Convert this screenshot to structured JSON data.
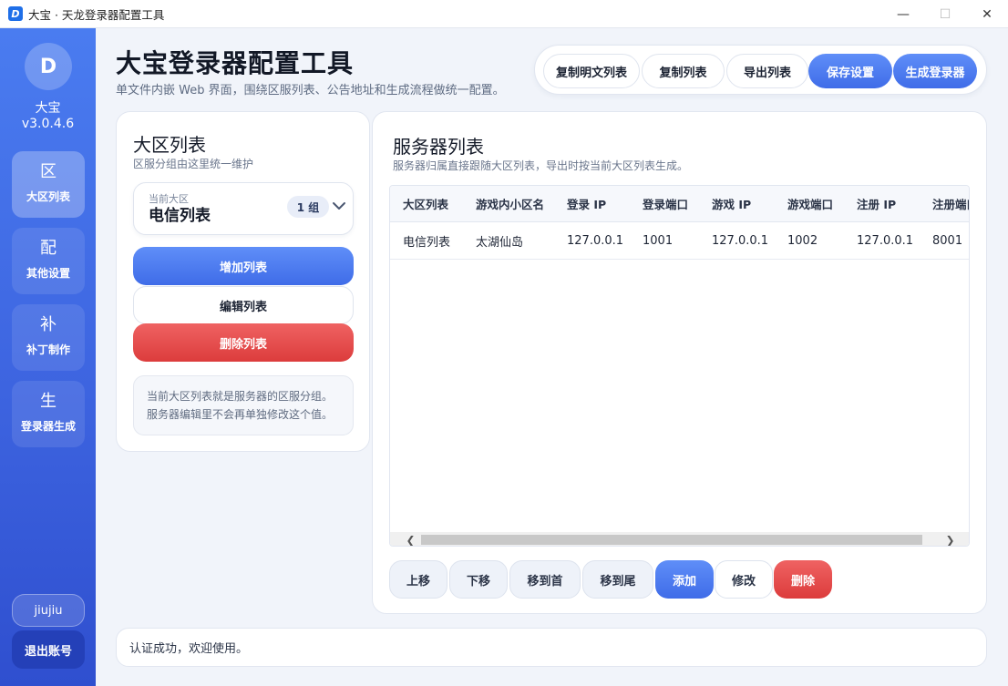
{
  "window": {
    "title": "大宝 · 天龙登录器配置工具",
    "controls": {
      "minimize": "—",
      "maximize": "☐",
      "close": "✕"
    }
  },
  "sidebar": {
    "logo_letter": "D",
    "user_name": "大宝",
    "version": "v3.0.4.6",
    "items": [
      {
        "glyph": "区",
        "label": "大区列表",
        "active": true
      },
      {
        "glyph": "配",
        "label": "其他设置",
        "active": false
      },
      {
        "glyph": "补",
        "label": "补丁制作",
        "active": false
      },
      {
        "glyph": "生",
        "label": "登录器生成",
        "active": false
      }
    ],
    "account": "jiujiu",
    "logout_label": "退出账号"
  },
  "header": {
    "title": "大宝登录器配置工具",
    "subtitle": "单文件内嵌 Web 界面，围绕区服列表、公告地址和生成流程做统一配置。"
  },
  "toolbar": {
    "copy_plain_label": "复制明文列表",
    "copy_label": "复制列表",
    "export_label": "导出列表",
    "save_label": "保存设置",
    "generate_label": "生成登录器"
  },
  "zone_panel": {
    "title": "大区列表",
    "subtitle": "区服分组由这里统一维护",
    "current_caption": "当前大区",
    "current_value": "电信列表",
    "group_count": "1 组",
    "add_label": "增加列表",
    "edit_label": "编辑列表",
    "delete_label": "删除列表",
    "note_line1": "当前大区列表就是服务器的区服分组。",
    "note_line2": "服务器编辑里不会再单独修改这个值。"
  },
  "server_panel": {
    "title": "服务器列表",
    "subtitle": "服务器归属直接跟随大区列表，导出时按当前大区列表生成。",
    "columns": [
      "大区列表",
      "游戏内小区名",
      "登录 IP",
      "登录端口",
      "游戏 IP",
      "游戏端口",
      "注册 IP",
      "注册端口"
    ],
    "rows": [
      [
        "电信列表",
        "太湖仙岛",
        "127.0.0.1",
        "1001",
        "127.0.0.1",
        "1002",
        "127.0.0.1",
        "8001"
      ]
    ],
    "scroll_left": "❮",
    "scroll_right": "❯",
    "actions": {
      "up": "上移",
      "down": "下移",
      "top": "移到首",
      "bottom": "移到尾",
      "add": "添加",
      "edit": "修改",
      "delete": "删除"
    }
  },
  "status": {
    "message": "认证成功，欢迎使用。"
  },
  "colors": {
    "accent": "#4a7cf0",
    "danger": "#e04848"
  }
}
